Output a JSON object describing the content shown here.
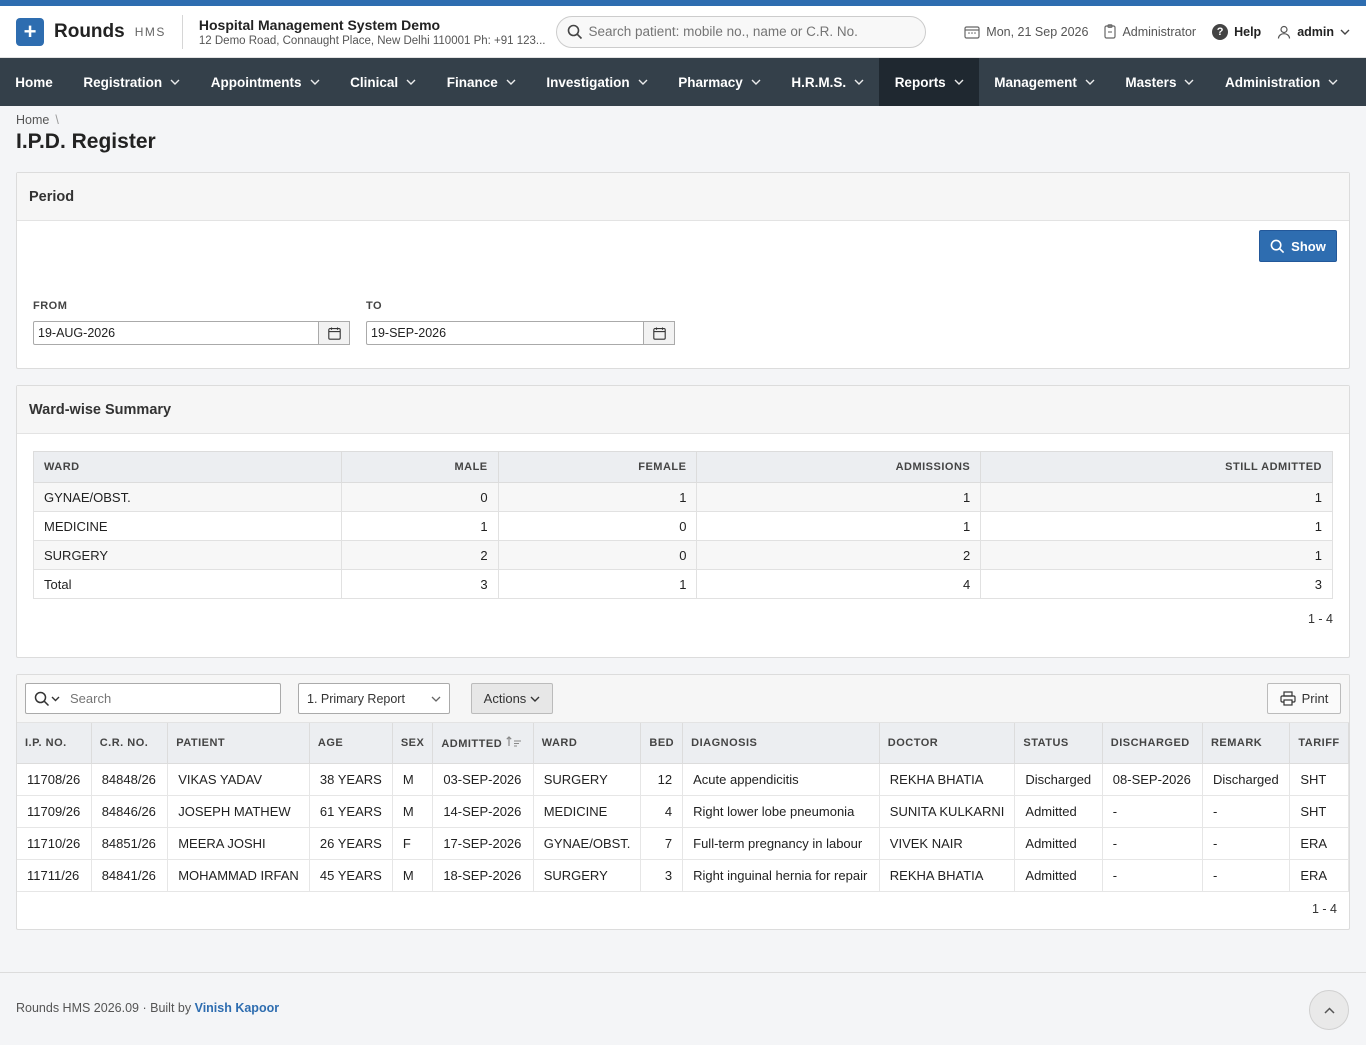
{
  "header": {
    "brand": "Rounds",
    "brand_sub": "HMS",
    "org_name": "Hospital Management System Demo",
    "org_address": "12 Demo Road, Connaught Place, New Delhi 110001 Ph: +91 123...",
    "search_placeholder": "Search patient: mobile no., name or C.R. No.",
    "date": "Mon, 21 Sep 2026",
    "role": "Administrator",
    "help": "Help",
    "user": "admin"
  },
  "nav": {
    "items": [
      "Home",
      "Registration",
      "Appointments",
      "Clinical",
      "Finance",
      "Investigation",
      "Pharmacy",
      "H.R.M.S.",
      "Reports",
      "Management",
      "Masters",
      "Administration"
    ],
    "active": "Reports"
  },
  "breadcrumb": {
    "home": "Home",
    "separator": "\\"
  },
  "page_title": "I.P.D. Register",
  "period": {
    "title": "Period",
    "show_label": "Show",
    "from_label": "FROM",
    "from_value": "19-AUG-2026",
    "to_label": "TO",
    "to_value": "19-SEP-2026"
  },
  "ward_summary": {
    "title": "Ward-wise Summary",
    "columns": [
      "WARD",
      "MALE",
      "FEMALE",
      "ADMISSIONS",
      "STILL ADMITTED"
    ],
    "rows": [
      [
        "GYNAE/OBST.",
        "0",
        "1",
        "1",
        "1"
      ],
      [
        "MEDICINE",
        "1",
        "0",
        "1",
        "1"
      ],
      [
        "SURGERY",
        "2",
        "0",
        "2",
        "1"
      ],
      [
        "Total",
        "3",
        "1",
        "4",
        "3"
      ]
    ],
    "pagination": "1 - 4"
  },
  "register": {
    "search_placeholder": "Search",
    "report_select": "1. Primary Report",
    "actions_label": "Actions",
    "print_label": "Print",
    "columns": [
      "I.P. NO.",
      "C.R. NO.",
      "PATIENT",
      "AGE",
      "SEX",
      "ADMITTED",
      "WARD",
      "BED",
      "DIAGNOSIS",
      "DOCTOR",
      "STATUS",
      "DISCHARGED",
      "REMARK",
      "TARIFF"
    ],
    "rows": [
      [
        "11708/26",
        "84848/26",
        "VIKAS YADAV",
        "38 YEARS",
        "M",
        "03-SEP-2026",
        "SURGERY",
        "12",
        "Acute appendicitis",
        "REKHA BHATIA",
        "Discharged",
        "08-SEP-2026",
        "Discharged",
        "SHT"
      ],
      [
        "11709/26",
        "84846/26",
        "JOSEPH MATHEW",
        "61 YEARS",
        "M",
        "14-SEP-2026",
        "MEDICINE",
        "4",
        "Right lower lobe pneumonia",
        "SUNITA KULKARNI",
        "Admitted",
        "-",
        "-",
        "SHT"
      ],
      [
        "11710/26",
        "84851/26",
        "MEERA JOSHI",
        "26 YEARS",
        "F",
        "17-SEP-2026",
        "GYNAE/OBST.",
        "7",
        "Full-term pregnancy in labour",
        "VIVEK NAIR",
        "Admitted",
        "-",
        "-",
        "ERA"
      ],
      [
        "11711/26",
        "84841/26",
        "MOHAMMAD IRFAN",
        "45 YEARS",
        "M",
        "18-SEP-2026",
        "SURGERY",
        "3",
        "Right inguinal hernia for repair",
        "REKHA BHATIA",
        "Admitted",
        "-",
        "-",
        "ERA"
      ]
    ],
    "pagination": "1 - 4"
  },
  "footer": {
    "text": "Rounds HMS 2026.09 · Built by ",
    "author": "Vinish Kapoor"
  }
}
